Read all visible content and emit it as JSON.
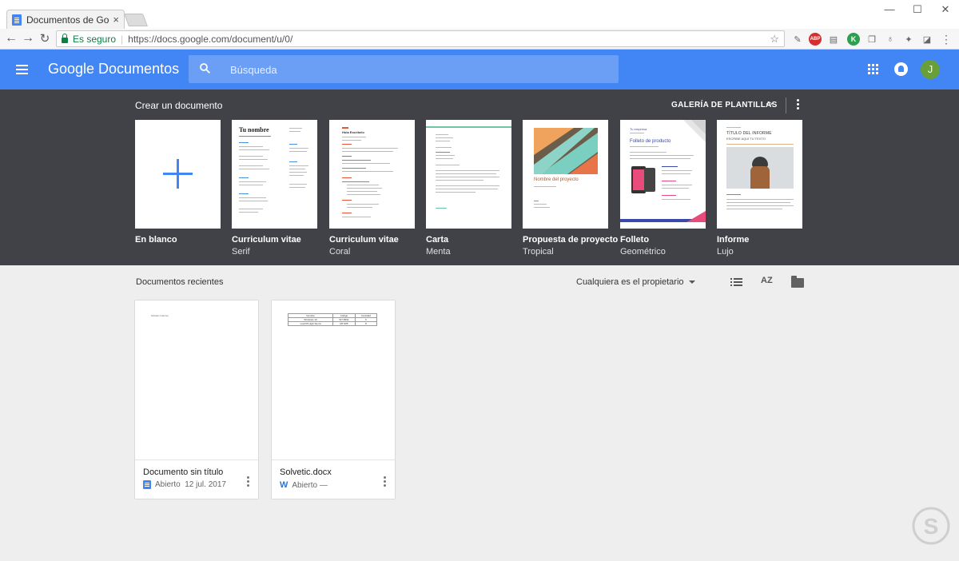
{
  "browser": {
    "tab_title": "Documentos de Google",
    "tab_close": "×",
    "window_min": "—",
    "window_max": "☐",
    "window_close": "✕",
    "secure_label": "Es seguro",
    "url": "https://docs.google.com/document/u/0/",
    "star": "☆",
    "ext_abp": "ABP",
    "ext_k": "K"
  },
  "appbar": {
    "title": "Google Documentos",
    "search_placeholder": "Búsqueda",
    "avatar_initial": "J",
    "color": "#4285f4"
  },
  "gallery": {
    "title": "Crear un documento",
    "gallery_link": "GALERÍA DE PLANTILLAS",
    "templates": [
      {
        "name": "En blanco",
        "sub": ""
      },
      {
        "name": "Curriculum vitae",
        "sub": "Serif"
      },
      {
        "name": "Curriculum vitae",
        "sub": "Coral"
      },
      {
        "name": "Carta",
        "sub": "Menta"
      },
      {
        "name": "Propuesta de proyecto",
        "sub": "Tropical"
      },
      {
        "name": "Folleto",
        "sub": "Geométrico"
      },
      {
        "name": "Informe",
        "sub": "Lujo"
      }
    ],
    "thumb_texts": {
      "serif_heading": "Tu nombre",
      "tropical_heading": "Nombre del proyecto",
      "geo_heading": "Folleto de producto",
      "geo_company": "Tu empresa",
      "lujo_heading": "TÍTULO DEL INFORME",
      "lujo_sub": "ESCRIBE AQUÍ TU TEXTO",
      "coral_heading": "Hola Escríbelo"
    }
  },
  "recent": {
    "title": "Documentos recientes",
    "owner_filter": "Cualquiera es el propietario",
    "sort_label": "AZ",
    "docs": [
      {
        "name": "Documento sin título",
        "status": "Abierto",
        "date": "12 jul. 2017",
        "type": "docs",
        "preview_text": "Solvetic Internet"
      },
      {
        "name": "Solvetic.docx",
        "status": "Abierto",
        "date": "—",
        "type": "word",
        "word_badge": "W",
        "table": [
          [
            "Nombre",
            "Código",
            "Cantidad"
          ],
          [
            "Windows 10",
            "W7-5661",
            "6"
          ],
          [
            "macOS High Sierra",
            "MT-965",
            "8"
          ]
        ]
      }
    ]
  }
}
